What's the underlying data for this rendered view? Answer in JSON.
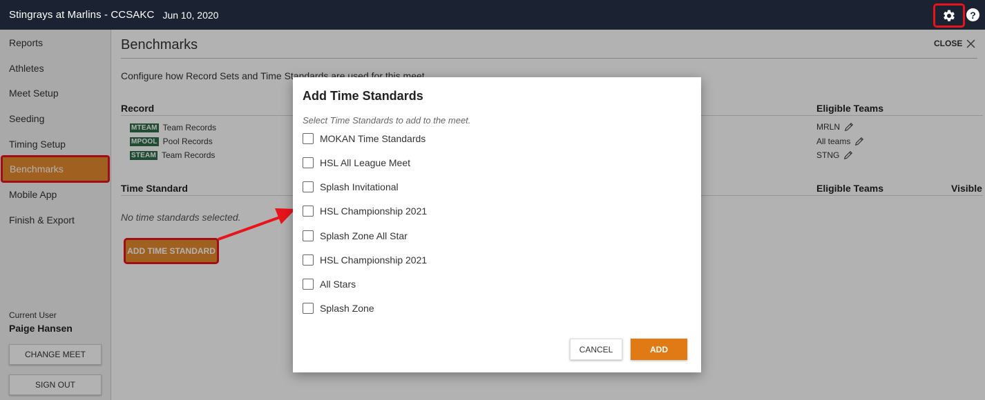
{
  "header": {
    "title": "Stingrays at Marlins - CCSAKC",
    "date": "Jun 10, 2020",
    "settings_icon": "gear-icon",
    "help_label": "?"
  },
  "sidebar": {
    "items": [
      {
        "label": "Reports"
      },
      {
        "label": "Athletes"
      },
      {
        "label": "Meet Setup"
      },
      {
        "label": "Seeding"
      },
      {
        "label": "Timing Setup"
      },
      {
        "label": "Benchmarks"
      },
      {
        "label": "Mobile App"
      },
      {
        "label": "Finish & Export"
      }
    ],
    "active_item": "Benchmarks",
    "current_user_label": "Current User",
    "current_user_name": "Paige Hansen",
    "change_meet_label": "CHANGE MEET",
    "sign_out_label": "SIGN OUT"
  },
  "main": {
    "title": "Benchmarks",
    "close_label": "CLOSE",
    "description": "Configure how Record Sets and Time Standards are used for this meet.",
    "record_header": "Record",
    "eligible_teams_header": "Eligible Teams",
    "records": [
      {
        "badge": "MTEAM",
        "name": "Team Records",
        "teams": "MRLN"
      },
      {
        "badge": "MPOOL",
        "name": "Pool Records",
        "teams": "All teams"
      },
      {
        "badge": "STEAM",
        "name": "Team Records",
        "teams": "STNG"
      }
    ],
    "time_standard_header": "Time Standard",
    "ts_eligible_teams_header": "Eligible Teams",
    "visible_header": "Visible",
    "empty_text": "No time standards selected.",
    "add_time_standard_label": "ADD TIME STANDARD"
  },
  "modal": {
    "title": "Add Time Standards",
    "subtitle": "Select Time Standards to add to the meet.",
    "options": [
      {
        "label": "MOKAN Time Standards",
        "checked": false
      },
      {
        "label": "HSL All League Meet",
        "checked": false
      },
      {
        "label": "Splash Invitational",
        "checked": false
      },
      {
        "label": "HSL Championship 2021",
        "checked": false
      },
      {
        "label": "Splash Zone All Star",
        "checked": false
      },
      {
        "label": "HSL Championship 2021",
        "checked": false
      },
      {
        "label": "All Stars",
        "checked": false
      },
      {
        "label": "Splash Zone",
        "checked": false
      }
    ],
    "cancel_label": "CANCEL",
    "add_label": "ADD"
  },
  "colors": {
    "topbar": "#1b2332",
    "accent": "#e07a14",
    "highlight": "#e8141c",
    "badge": "#2d6e4a"
  }
}
